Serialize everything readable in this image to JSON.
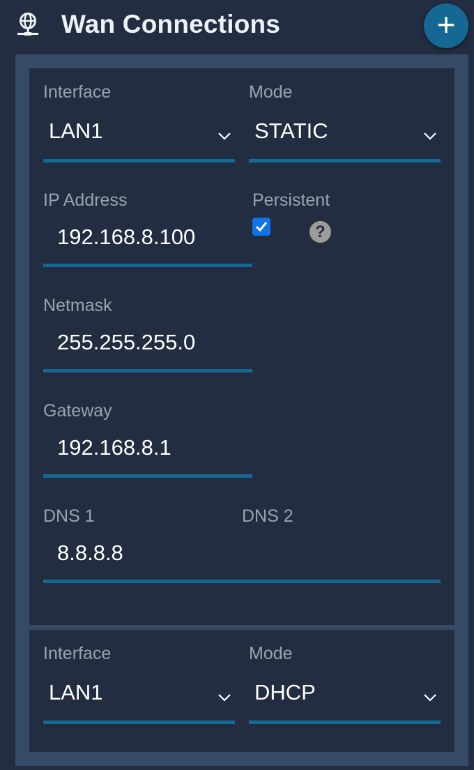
{
  "header": {
    "title": "Wan Connections",
    "icon": "network-globe-icon",
    "add_label": "+"
  },
  "connections": [
    {
      "interface_label": "Interface",
      "interface_value": "LAN1",
      "mode_label": "Mode",
      "mode_value": "STATIC",
      "ip_label": "IP Address",
      "ip_value": "192.168.8.100",
      "persistent_label": "Persistent",
      "persistent_checked": true,
      "help_label": "?",
      "netmask_label": "Netmask",
      "netmask_value": "255.255.255.0",
      "gateway_label": "Gateway",
      "gateway_value": "192.168.8.1",
      "dns1_label": "DNS 1",
      "dns1_value": "8.8.8.8",
      "dns2_label": "DNS 2",
      "dns2_value": ""
    },
    {
      "interface_label": "Interface",
      "interface_value": "LAN1",
      "mode_label": "Mode",
      "mode_value": "DHCP"
    }
  ],
  "colors": {
    "background": "#222d41",
    "panel": "#344a65",
    "accent": "#156894",
    "checkbox": "#1173e6",
    "label": "#9aa3ad"
  }
}
